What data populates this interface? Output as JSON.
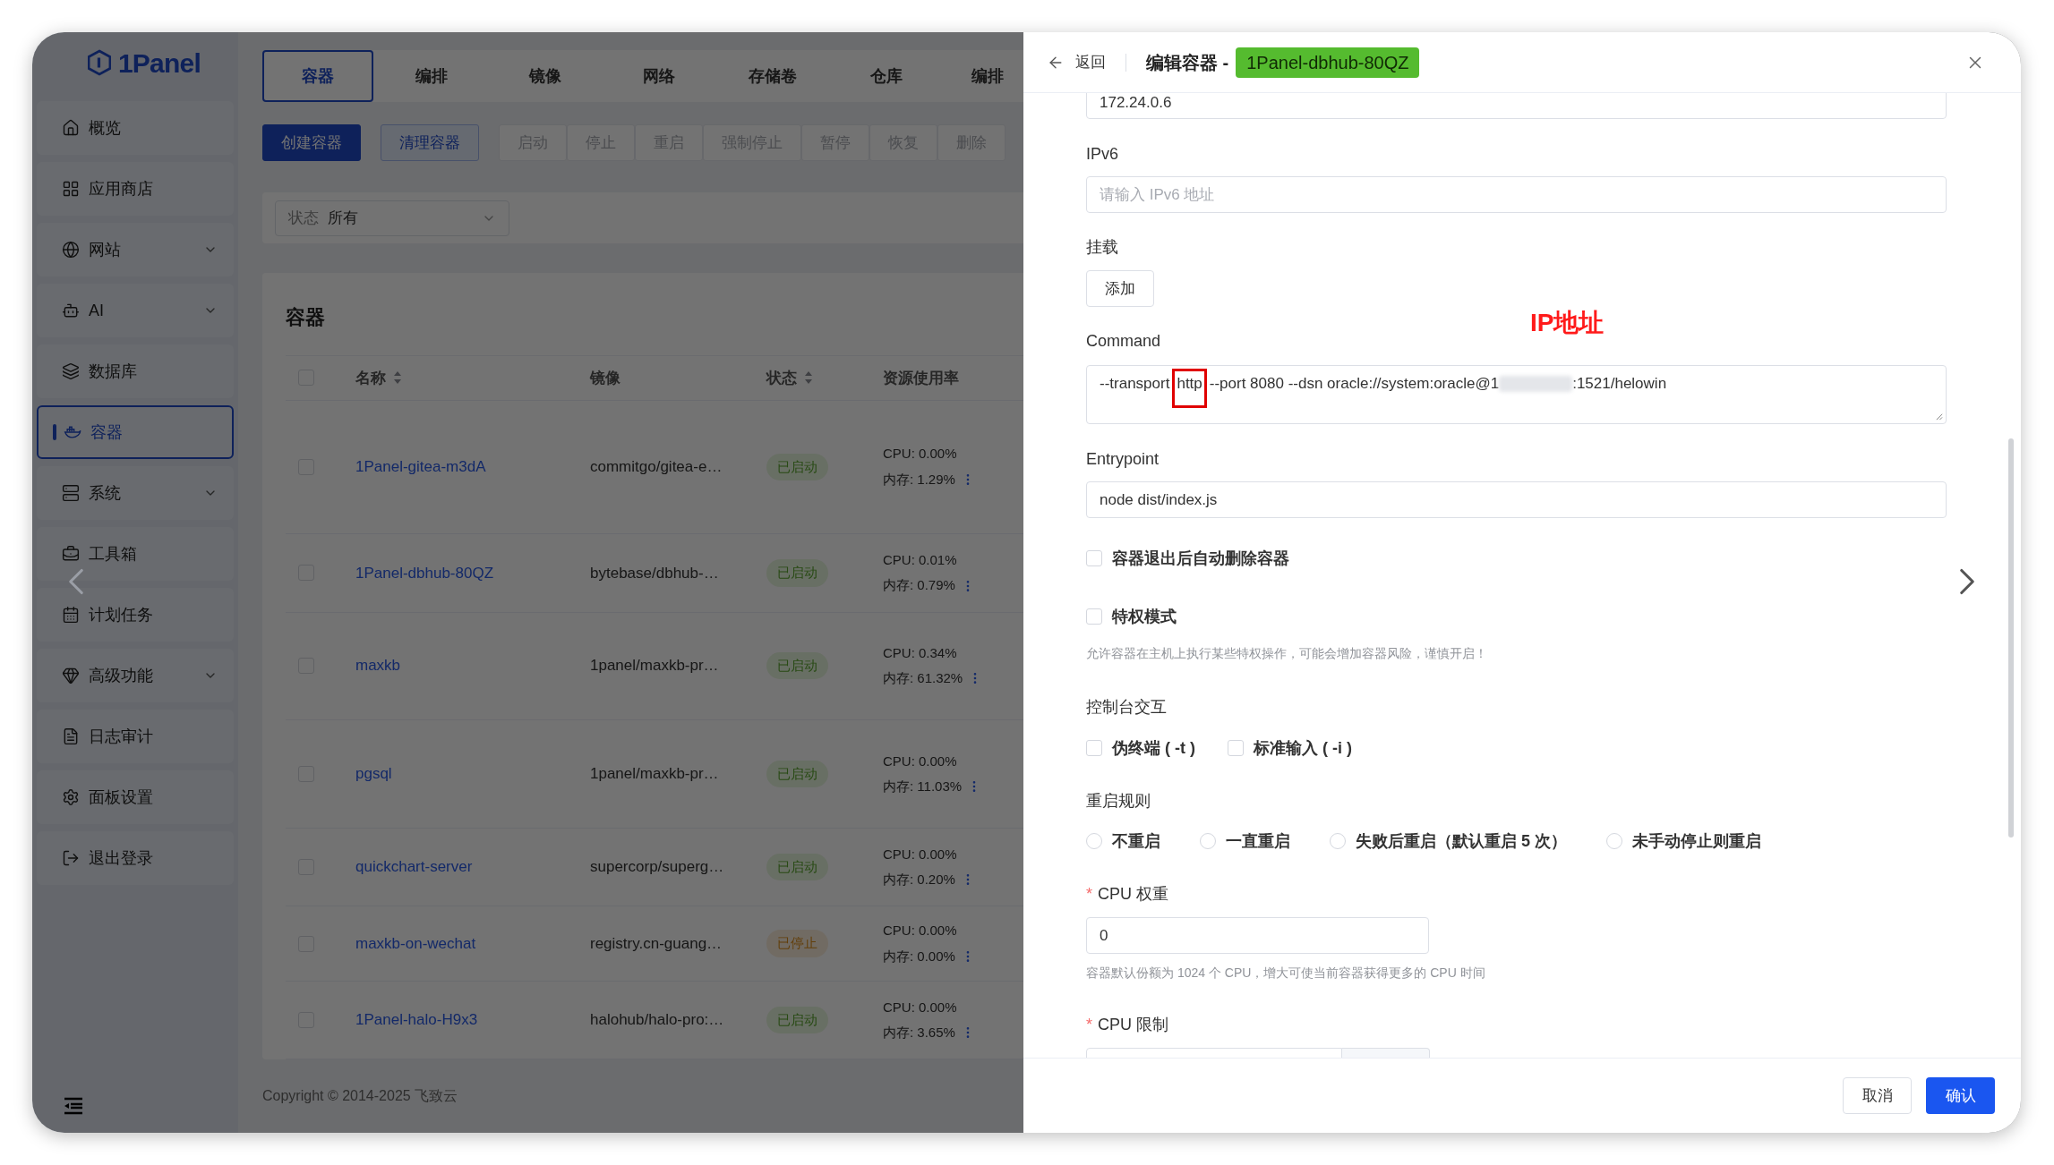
{
  "sidebar": {
    "logo": "1Panel",
    "items": [
      {
        "label": "概览",
        "expandable": false,
        "selected": false
      },
      {
        "label": "应用商店",
        "expandable": false,
        "selected": false
      },
      {
        "label": "网站",
        "expandable": true,
        "selected": false
      },
      {
        "label": "AI",
        "expandable": true,
        "selected": false
      },
      {
        "label": "数据库",
        "expandable": false,
        "selected": false
      },
      {
        "label": "容器",
        "expandable": false,
        "selected": true
      },
      {
        "label": "系统",
        "expandable": true,
        "selected": false
      },
      {
        "label": "工具箱",
        "expandable": false,
        "selected": false
      },
      {
        "label": "计划任务",
        "expandable": false,
        "selected": false
      },
      {
        "label": "高级功能",
        "expandable": true,
        "selected": false
      },
      {
        "label": "日志审计",
        "expandable": false,
        "selected": false
      },
      {
        "label": "面板设置",
        "expandable": false,
        "selected": false
      },
      {
        "label": "退出登录",
        "expandable": false,
        "selected": false
      }
    ]
  },
  "tabs": [
    {
      "label": "容器",
      "selected": true
    },
    {
      "label": "编排",
      "selected": false
    },
    {
      "label": "镜像",
      "selected": false
    },
    {
      "label": "网络",
      "selected": false
    },
    {
      "label": "存储卷",
      "selected": false
    },
    {
      "label": "仓库",
      "selected": false
    },
    {
      "label": "编排",
      "selected": false
    }
  ],
  "toolbar": [
    {
      "label": "创建容器",
      "kind": "primary"
    },
    {
      "label": "清理容器",
      "kind": "secondary"
    },
    {
      "label": "启动",
      "kind": "disabled"
    },
    {
      "label": "停止",
      "kind": "disabled"
    },
    {
      "label": "重启",
      "kind": "disabled"
    },
    {
      "label": "强制停止",
      "kind": "disabled"
    },
    {
      "label": "暂停",
      "kind": "disabled"
    },
    {
      "label": "恢复",
      "kind": "disabled"
    },
    {
      "label": "删除",
      "kind": "disabled"
    }
  ],
  "filter": {
    "label": "状态",
    "value": "所有"
  },
  "table": {
    "title": "容器",
    "all_checked": false,
    "columns": [
      {
        "label": "名称",
        "sortable": true
      },
      {
        "label": "镜像",
        "sortable": false
      },
      {
        "label": "状态",
        "sortable": true
      },
      {
        "label": "资源使用率",
        "sortable": false
      }
    ],
    "rows": [
      {
        "checked": false,
        "name": "1Panel-gitea-m3dA",
        "image": "commitgo/gitea-e…",
        "status": {
          "label": "已启动",
          "kind": "running"
        },
        "cpu": "CPU: 0.00%",
        "memory": "内存: 1.29%"
      },
      {
        "checked": false,
        "name": "1Panel-dbhub-80QZ",
        "image": "bytebase/dbhub-…",
        "status": {
          "label": "已启动",
          "kind": "running"
        },
        "cpu": "CPU: 0.01%",
        "memory": "内存: 0.79%"
      },
      {
        "checked": false,
        "name": "maxkb",
        "image": "1panel/maxkb-pr…",
        "status": {
          "label": "已启动",
          "kind": "running"
        },
        "cpu": "CPU: 0.34%",
        "memory": "内存: 61.32%"
      },
      {
        "checked": false,
        "name": "pgsql",
        "image": "1panel/maxkb-pr…",
        "status": {
          "label": "已启动",
          "kind": "running"
        },
        "cpu": "CPU: 0.00%",
        "memory": "内存: 11.03%"
      },
      {
        "checked": false,
        "name": "quickchart-server",
        "image": "supercorp/superg…",
        "status": {
          "label": "已启动",
          "kind": "running"
        },
        "cpu": "CPU: 0.00%",
        "memory": "内存: 0.20%"
      },
      {
        "checked": false,
        "name": "maxkb-on-wechat",
        "image": "registry.cn-guang…",
        "status": {
          "label": "已停止",
          "kind": "stopped"
        },
        "cpu": "CPU: 0.00%",
        "memory": "内存: 0.00%"
      },
      {
        "checked": false,
        "name": "1Panel-halo-H9x3",
        "image": "halohub/halo-pro:…",
        "status": {
          "label": "已启动",
          "kind": "running"
        },
        "cpu": "CPU: 0.00%",
        "memory": "内存: 3.65%"
      }
    ]
  },
  "copyright": "Copyright © 2014-2025 飞致云",
  "drawer": {
    "back": "返回",
    "title": "编辑容器 -",
    "badge": "1Panel-dbhub-80QZ",
    "ipv4": {
      "value": "172.24.0.6"
    },
    "ipv6": {
      "label": "IPv6",
      "placeholder": "请输入 IPv6 地址"
    },
    "mounts": {
      "label": "挂载",
      "button": "添加"
    },
    "annotation": {
      "text": "IP地址"
    },
    "command": {
      "label": "Command",
      "parts": [
        {
          "kind": "text",
          "text": "--transport"
        },
        {
          "kind": "highlight",
          "text": "http"
        },
        {
          "kind": "text",
          "text": "--port 8080 --dsn oracle://system:oracle@1"
        },
        {
          "kind": "redacted"
        },
        {
          "kind": "text",
          "text": ":1521/helowin"
        }
      ]
    },
    "entrypoint": {
      "label": "Entrypoint",
      "value": "node dist/index.js"
    },
    "auto_remove": {
      "label": "容器退出后自动删除容器",
      "checked": false
    },
    "privileged": {
      "label": "特权模式",
      "checked": false,
      "hint": "允许容器在主机上执行某些特权操作，可能会增加容器风险，谨慎开启！"
    },
    "console": {
      "label": "控制台交互",
      "options": [
        {
          "label": "伪终端 ( -t )",
          "checked": false
        },
        {
          "label": "标准输入 ( -i )",
          "checked": false
        }
      ]
    },
    "restart": {
      "label": "重启规则",
      "options": [
        {
          "label": "不重启",
          "selected": false
        },
        {
          "label": "一直重启",
          "selected": false
        },
        {
          "label": "失败后重启（默认重启 5 次）",
          "selected": false
        },
        {
          "label": "未手动停止则重启",
          "selected": false
        }
      ]
    },
    "cpu_shares": {
      "mark": "*",
      "label": "CPU 权重",
      "value": "0",
      "hint": "容器默认份额为 1024 个 CPU，增大可使当前容器获得更多的 CPU 时间"
    },
    "cpu_limit": {
      "mark": "*",
      "label": "CPU 限制"
    },
    "buttons": [
      {
        "label": "取消",
        "kind": "secondary"
      },
      {
        "label": "确认",
        "kind": "primary"
      }
    ]
  }
}
